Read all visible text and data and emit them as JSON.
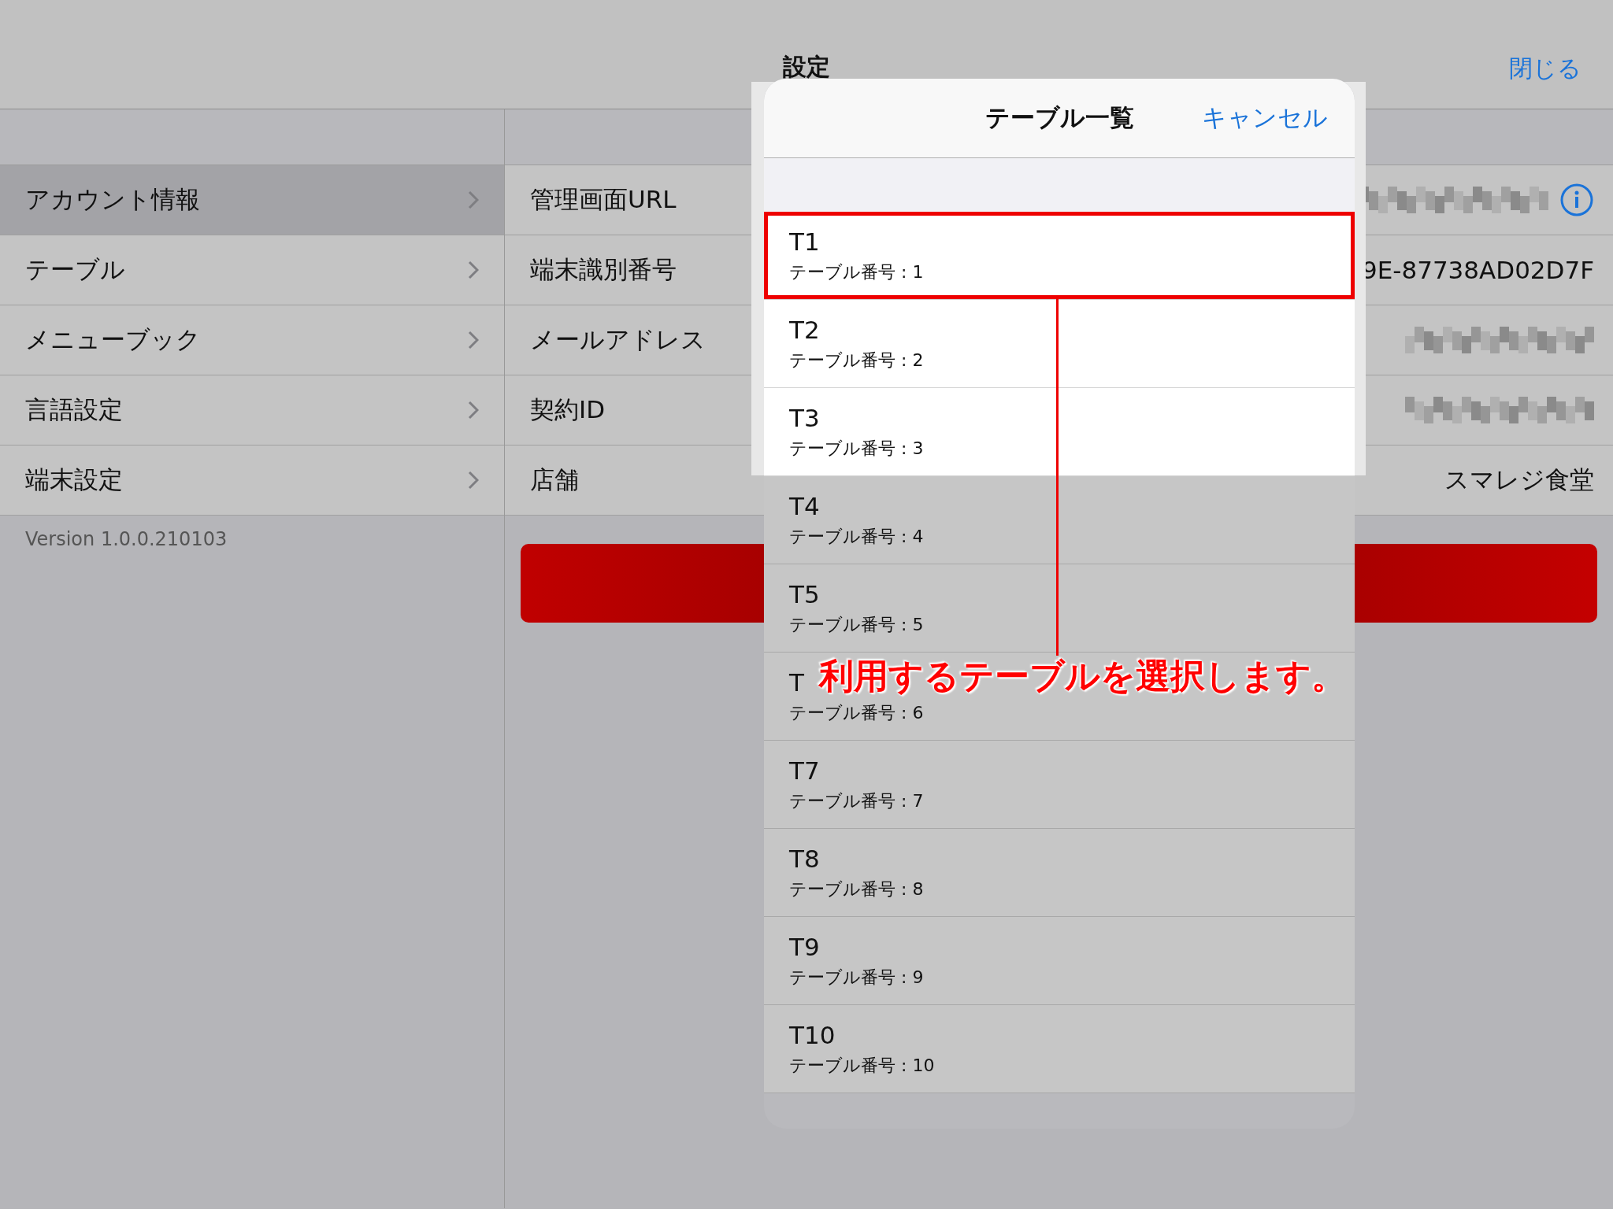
{
  "nav": {
    "title": "設定",
    "close": "閉じる"
  },
  "sidebar": {
    "items": [
      {
        "label": "アカウント情報",
        "selected": true
      },
      {
        "label": "テーブル",
        "selected": false
      },
      {
        "label": "メニューブック",
        "selected": false
      },
      {
        "label": "言語設定",
        "selected": false
      },
      {
        "label": "端末設定",
        "selected": false
      }
    ],
    "version": "Version 1.0.0.210103"
  },
  "detail": {
    "rows": [
      {
        "label": "管理画面URL",
        "kind": "redacted",
        "info": true
      },
      {
        "label": "端末識別番号",
        "kind": "text",
        "value": "9E-87738AD02D7F",
        "info": false
      },
      {
        "label": "メールアドレス",
        "kind": "redacted",
        "info": false
      },
      {
        "label": "契約ID",
        "kind": "redacted",
        "info": false
      },
      {
        "label": "店舗",
        "kind": "text",
        "value": "スマレジ食堂",
        "info": false
      }
    ]
  },
  "picker": {
    "title": "テーブル一覧",
    "cancel": "キャンセル",
    "rows": [
      {
        "title": "T1",
        "subtitle": "テーブル番号 : 1",
        "selected": true,
        "dimmed": false
      },
      {
        "title": "T2",
        "subtitle": "テーブル番号 : 2",
        "selected": false,
        "dimmed": false
      },
      {
        "title": "T3",
        "subtitle": "テーブル番号 : 3",
        "selected": false,
        "dimmed": false
      },
      {
        "title": "T4",
        "subtitle": "テーブル番号 : 4",
        "selected": false,
        "dimmed": true
      },
      {
        "title": "T5",
        "subtitle": "テーブル番号 : 5",
        "selected": false,
        "dimmed": true
      },
      {
        "title": "T",
        "subtitle": "テーブル番号 : 6",
        "selected": false,
        "dimmed": true,
        "annotation": "利用するテーブルを選択します。"
      },
      {
        "title": "T7",
        "subtitle": "テーブル番号 : 7",
        "selected": false,
        "dimmed": true
      },
      {
        "title": "T8",
        "subtitle": "テーブル番号 : 8",
        "selected": false,
        "dimmed": true
      },
      {
        "title": "T9",
        "subtitle": "テーブル番号 : 9",
        "selected": false,
        "dimmed": true
      },
      {
        "title": "T10",
        "subtitle": "テーブル番号 : 10",
        "selected": false,
        "dimmed": true
      }
    ]
  }
}
